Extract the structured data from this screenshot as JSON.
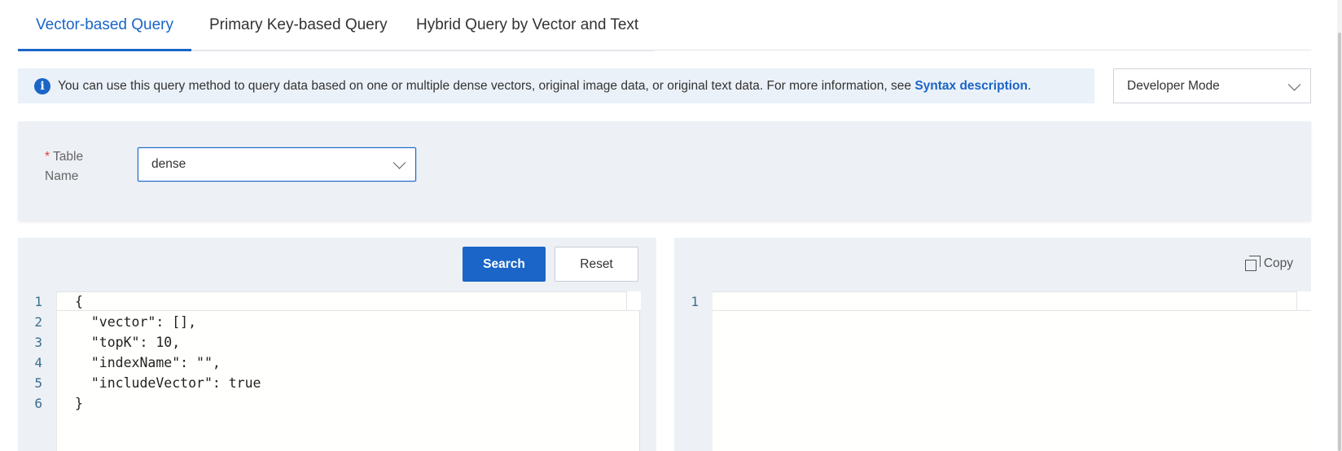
{
  "tabs": {
    "vector": "Vector-based Query",
    "primary": "Primary Key-based Query",
    "hybrid": "Hybrid Query by Vector and Text"
  },
  "info": {
    "text": "You can use this query method to query data based on one or multiple dense vectors, original image data, or original text data. For more information, see",
    "link": "Syntax description",
    "suffix": "."
  },
  "mode_select": {
    "value": "Developer Mode"
  },
  "form": {
    "required_mark": "*",
    "label": "Table Name",
    "table_value": "dense"
  },
  "buttons": {
    "search": "Search",
    "reset": "Reset",
    "copy": "Copy"
  },
  "editor": {
    "line_numbers": [
      "1",
      "2",
      "3",
      "4",
      "5",
      "6"
    ],
    "lines": [
      "{",
      "  \"vector\": [],",
      "  \"topK\": 10,",
      "  \"indexName\": \"\",",
      "  \"includeVector\": true",
      "}"
    ]
  },
  "result": {
    "line_numbers": [
      "1"
    ]
  },
  "colors": {
    "accent": "#1a65c7",
    "panel": "#edf0f5",
    "banner": "#ebf1f9",
    "required": "#e23c39"
  },
  "icons": {
    "info": "info-circle-icon",
    "chevron": "chevron-down-icon",
    "copy": "copy-icon"
  }
}
